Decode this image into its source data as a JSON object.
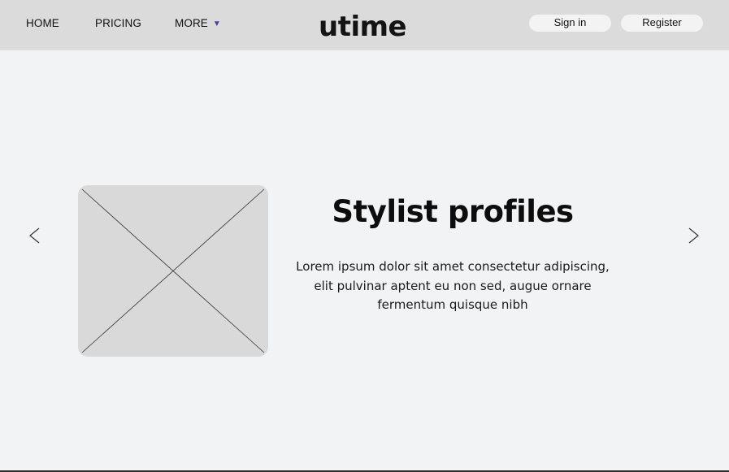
{
  "nav": {
    "home": "HOME",
    "pricing": "PRICING",
    "more": "MORE",
    "more_caret": "▼"
  },
  "logo": {
    "text": "utime",
    "icon": "clock-hand-icon"
  },
  "auth": {
    "signin": "Sign in",
    "register": "Register"
  },
  "carousel": {
    "prev_icon": "chevron-left-icon",
    "next_icon": "chevron-right-icon",
    "image_icon": "image-placeholder-icon",
    "title": "Stylist profiles",
    "description_lines": [
      "Lorem ipsum dolor sit amet consectetur adipiscing,",
      "elit pulvinar aptent eu non sed, augue ornare",
      "fermentum quisque nibh"
    ]
  },
  "colors": {
    "header_bg": "#dbdbdb",
    "page_bg": "#f2f3f5",
    "pill_bg": "#f3f3f3",
    "placeholder_bg": "#d9d9d9",
    "caret": "#4b3f9a"
  }
}
